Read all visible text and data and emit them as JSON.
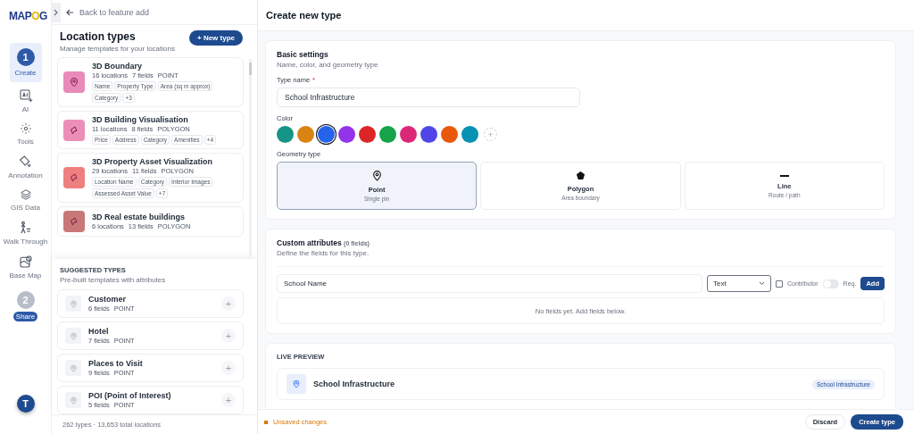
{
  "logo": {
    "parts": [
      "MAP",
      "O",
      "G"
    ]
  },
  "back_link": "Back to feature add",
  "nav": [
    {
      "kind": "step",
      "number": "1",
      "label": "Create",
      "selected": true
    },
    {
      "kind": "tool",
      "label": "AI"
    },
    {
      "kind": "tool",
      "label": "Tools"
    },
    {
      "kind": "tool",
      "label": "Annotation"
    },
    {
      "kind": "tool",
      "label": "GIS Data"
    },
    {
      "kind": "tool",
      "label": "Walk Through"
    },
    {
      "kind": "tool",
      "label": "Base Map"
    },
    {
      "kind": "step",
      "number": "2",
      "label": "Share",
      "selected": false
    }
  ],
  "avatar": "T",
  "location_types": {
    "title": "Location types",
    "subtitle": "Manage templates for your locations",
    "new_button": "+ New type",
    "items": [
      {
        "name": "3D Boundary",
        "locations": "16 locations",
        "fields": "7 fields",
        "geometry": "POINT",
        "kind": "point",
        "color": "#e88bb8",
        "tags": [
          "Name",
          "Property Type",
          "Area (sq m approx)",
          "Category",
          "+3"
        ]
      },
      {
        "name": "3D Building Visualisation",
        "locations": "11 locations",
        "fields": "8 fields",
        "geometry": "POLYGON",
        "kind": "polygon",
        "color": "#ec8fb8",
        "tags": [
          "Price",
          "Address",
          "Category",
          "Amenities",
          "+4"
        ]
      },
      {
        "name": "3D Property Asset Visualization",
        "locations": "29 locations",
        "fields": "11 fields",
        "geometry": "POLYGON",
        "kind": "polygon",
        "color": "#ee7f7f",
        "tags": [
          "Location Name",
          "Category",
          "Interior Images",
          "Assessed Asset Value",
          "+7"
        ]
      },
      {
        "name": "3D Real estate buildings",
        "locations": "6 locations",
        "fields": "13 fields",
        "geometry": "POLYGON",
        "kind": "polygon",
        "color": "#c97878"
      }
    ]
  },
  "suggested": {
    "title": "SUGGESTED TYPES",
    "subtitle": "Pre-built templates with attributes",
    "items": [
      {
        "name": "Customer",
        "fields": "6 fields",
        "geometry": "POINT",
        "add": "+"
      },
      {
        "name": "Hotel",
        "fields": "7 fields",
        "geometry": "POINT",
        "add": "+"
      },
      {
        "name": "Places to Visit",
        "fields": "9 fields",
        "geometry": "POINT",
        "add": "+"
      },
      {
        "name": "POI (Point of Interest)",
        "fields": "5 fields",
        "geometry": "POINT",
        "add": "+"
      }
    ]
  },
  "summary": "262 types · 13,653 total locations",
  "page_title": "Create new type",
  "basic": {
    "title": "Basic settings",
    "subtitle": "Name, color, and geometry type",
    "name_label": "Type name",
    "required_mark": "*",
    "name_value": "School Infrastructure",
    "color_label": "Color",
    "colors": [
      {
        "color": "#169487",
        "selected": false
      },
      {
        "color": "#d98314",
        "selected": false
      },
      {
        "color": "#2563eb",
        "selected": true
      },
      {
        "color": "#9333ea",
        "selected": false
      },
      {
        "color": "#dc2626",
        "selected": false
      },
      {
        "color": "#16a34a",
        "selected": false
      },
      {
        "color": "#db2777",
        "selected": false
      },
      {
        "color": "#4f46e5",
        "selected": false
      },
      {
        "color": "#ea580c",
        "selected": false
      },
      {
        "color": "#0891b2",
        "selected": false
      }
    ],
    "add_color": "+",
    "geometry_label": "Geometry type",
    "geometries": [
      {
        "kind": "point",
        "label": "Point",
        "hint": "Single pin",
        "selected": true
      },
      {
        "kind": "polygon",
        "label": "Polygon",
        "hint": "Area boundary",
        "selected": false
      },
      {
        "kind": "line",
        "label": "Line",
        "hint": "Route / path",
        "selected": false
      }
    ]
  },
  "attributes": {
    "title": "Custom attributes",
    "count": "(0 fields)",
    "subtitle": "Define the fields for this type.",
    "name_value": "School Name",
    "type_value": "Text",
    "contributor": {
      "label": "Contributor",
      "checked": false
    },
    "required": {
      "label": "Req.",
      "on": false
    },
    "add_button": "Add",
    "empty": "No fields yet. Add fields below."
  },
  "preview": {
    "title": "LIVE PREVIEW",
    "name": "School Infrastructure",
    "badge": "School Infrastructure"
  },
  "footer": {
    "status": "Unsaved changes",
    "discard": "Discard",
    "create": "Create type"
  }
}
